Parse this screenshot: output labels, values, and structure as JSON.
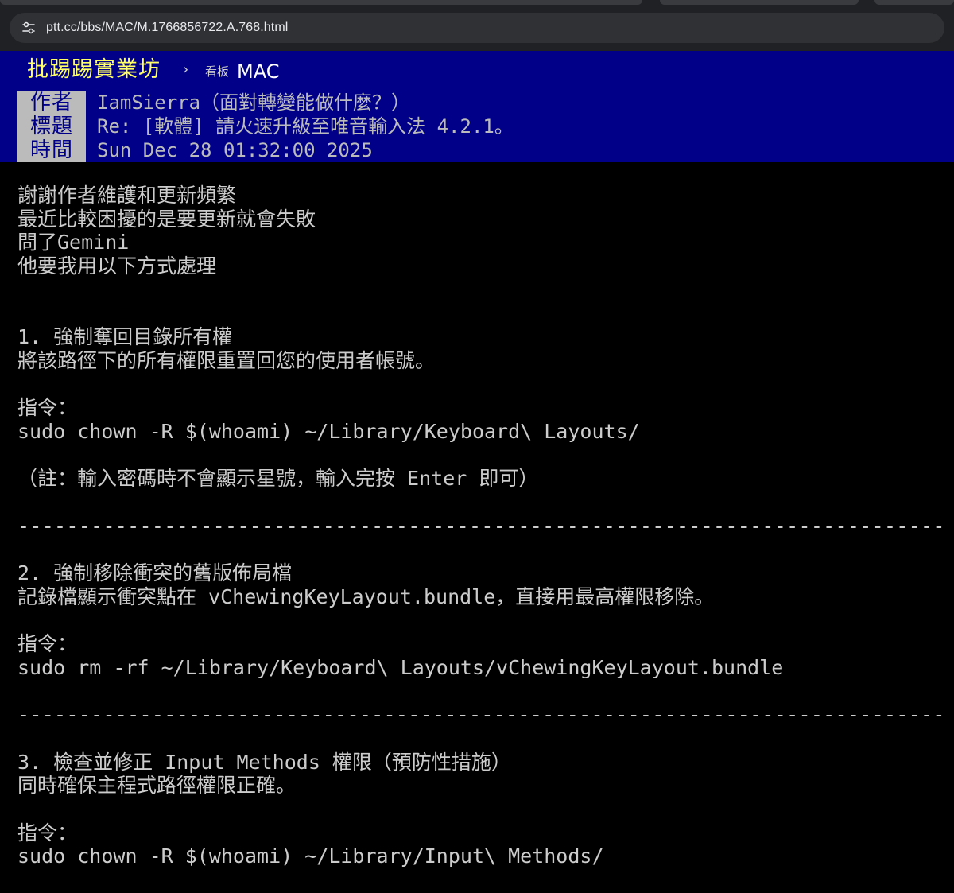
{
  "browser": {
    "url": "ptt.cc/bbs/MAC/M.1766856722.A.768.html",
    "site_icon": "tune-icon"
  },
  "topbar": {
    "brand": "批踢踢實業坊",
    "separator": "›",
    "board_label": "看板",
    "board_name": "MAC"
  },
  "meta": [
    {
      "key": "作者",
      "value": "IamSierra（面對轉變能做什麼？）"
    },
    {
      "key": "標題",
      "value": "Re: [軟體] 請火速升級至唯音輸入法 4.2.1。"
    },
    {
      "key": "時間",
      "value": "Sun Dec 28 01:32:00 2025"
    }
  ],
  "body": {
    "lines": [
      "謝謝作者維護和更新頻繁",
      "最近比較困擾的是要更新就會失敗",
      "問了Gemini",
      "他要我用以下方式處理",
      "",
      "",
      "1. 強制奪回目錄所有權",
      "將該路徑下的所有權限重置回您的使用者帳號。",
      "",
      "指令：",
      "sudo chown -R $(whoami) ~/Library/Keyboard\\ Layouts/",
      "",
      "（註：輸入密碼時不會顯示星號，輸入完按 Enter 即可）",
      "",
      "--------------------------------------------------------------------------------",
      "",
      "2. 強制移除衝突的舊版佈局檔",
      "記錄檔顯示衝突點在 vChewingKeyLayout.bundle，直接用最高權限移除。",
      "",
      "指令：",
      "sudo rm -rf ~/Library/Keyboard\\ Layouts/vChewingKeyLayout.bundle",
      "",
      "--------------------------------------------------------------------------------",
      "",
      "3. 檢查並修正 Input Methods 權限（預防性措施）",
      "同時確保主程式路徑權限正確。",
      "",
      "指令：",
      "sudo chown -R $(whoami) ~/Library/Input\\ Methods/"
    ]
  }
}
